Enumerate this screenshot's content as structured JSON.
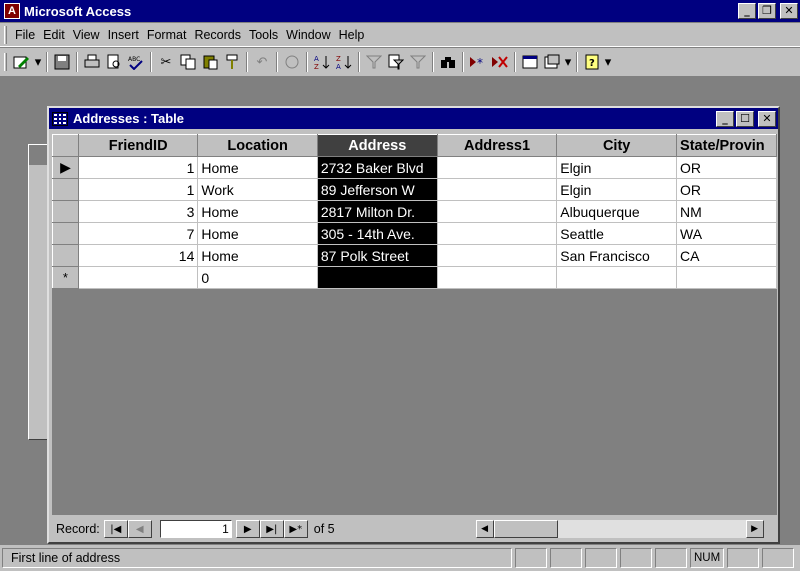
{
  "app": {
    "title": "Microsoft Access",
    "icon_letter": "A"
  },
  "window_controls": {
    "minimize": "_",
    "restore": "❐",
    "close": "✕"
  },
  "menu": [
    "File",
    "Edit",
    "View",
    "Insert",
    "Format",
    "Records",
    "Tools",
    "Window",
    "Help"
  ],
  "toolbar_icons": [
    "design-view-icon",
    "save-icon",
    "print-icon",
    "print-preview-icon",
    "spelling-icon",
    "cut-icon",
    "copy-icon",
    "paste-icon",
    "format-painter-icon",
    "undo-icon",
    "insert-hyperlink-icon",
    "sort-ascending-icon",
    "sort-descending-icon",
    "filter-by-selection-icon",
    "filter-by-form-icon",
    "apply-filter-icon",
    "find-icon",
    "new-record-icon",
    "delete-record-icon",
    "properties-icon",
    "database-window-icon",
    "new-object-icon",
    "help-icon"
  ],
  "table_window": {
    "title": "Addresses : Table",
    "columns": [
      "FriendID",
      "Location",
      "Address",
      "Address1",
      "City",
      "State/Provin"
    ],
    "selected_column": "Address",
    "rows": [
      {
        "marker": "▶",
        "cells": [
          "1",
          "Home",
          "2732 Baker Blvd",
          "",
          "Elgin",
          "OR"
        ]
      },
      {
        "marker": "",
        "cells": [
          "1",
          "Work",
          "89 Jefferson W",
          "",
          "Elgin",
          "OR"
        ]
      },
      {
        "marker": "",
        "cells": [
          "3",
          "Home",
          "2817 Milton Dr.",
          "",
          "Albuquerque",
          "NM"
        ]
      },
      {
        "marker": "",
        "cells": [
          "7",
          "Home",
          "305 - 14th Ave.",
          "",
          "Seattle",
          "WA"
        ]
      },
      {
        "marker": "",
        "cells": [
          "14",
          "Home",
          "87 Polk Street",
          "",
          "San Francisco",
          "CA"
        ]
      },
      {
        "marker": "*",
        "cells": [
          "",
          "0",
          "",
          "",
          "",
          ""
        ]
      }
    ]
  },
  "navigation": {
    "label": "Record:",
    "current": "1",
    "of_text": "of 5"
  },
  "status": {
    "text": "First line of address",
    "num": "NUM"
  },
  "colors": {
    "titlebar": "#000080",
    "face": "#c0c0c0",
    "mdi": "#808080"
  }
}
